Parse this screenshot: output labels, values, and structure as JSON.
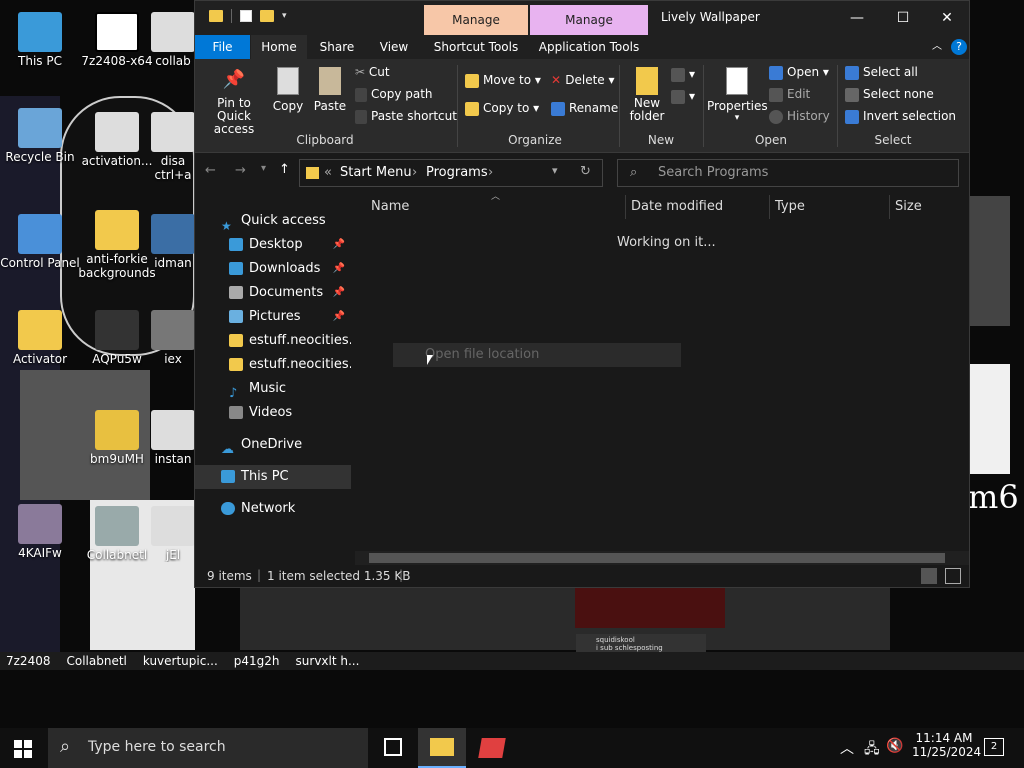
{
  "colors": {
    "accent": "#0078d7",
    "folder": "#f2c94c",
    "manage1": "#f7c7a8",
    "manage2": "#e8b3f0"
  },
  "desktop_icons": [
    {
      "label": "This PC"
    },
    {
      "label": "7z2408-x64"
    },
    {
      "label": "collab"
    },
    {
      "label": "Recycle Bin"
    },
    {
      "label": "activation..."
    },
    {
      "label": "disa ctrl+a"
    },
    {
      "label": "Control Panel"
    },
    {
      "label": "anti-forkie backgrounds"
    },
    {
      "label": "idman"
    },
    {
      "label": "Activator"
    },
    {
      "label": "AQPu5w"
    },
    {
      "label": "iex"
    },
    {
      "label": "bm9uMH"
    },
    {
      "label": "instan"
    },
    {
      "label": "4KAIFw"
    },
    {
      "label": "Collabnetl"
    },
    {
      "label": "jEl"
    }
  ],
  "wallpaper_bar": {
    "items": [
      "7z2408",
      "Collabnetl",
      "kuvertupic...",
      "p41g2h",
      "survxlt h..."
    ],
    "overlay_text": "m6",
    "chat_text": "squidiskool",
    "chat_sub": "i sub schlesposting"
  },
  "explorer": {
    "title": "Lively Wallpaper",
    "context_tabs": [
      "Manage",
      "Manage"
    ],
    "context_labels": [
      "Shortcut Tools",
      "Application Tools"
    ],
    "tabs": [
      "File",
      "Home",
      "Share",
      "View"
    ],
    "ribbon": {
      "clipboard": {
        "pin": "Pin to Quick access",
        "copy": "Copy",
        "paste": "Paste",
        "cut": "Cut",
        "copy_path": "Copy path",
        "paste_shortcut": "Paste shortcut",
        "group": "Clipboard"
      },
      "organize": {
        "move_to": "Move to",
        "copy_to": "Copy to",
        "delete": "Delete",
        "rename": "Rename",
        "group": "Organize"
      },
      "new": {
        "new_folder": "New folder",
        "group": "New"
      },
      "open": {
        "properties": "Properties",
        "open": "Open",
        "edit": "Edit",
        "history": "History",
        "group": "Open"
      },
      "select": {
        "select_all": "Select all",
        "select_none": "Select none",
        "invert": "Invert selection",
        "group": "Select"
      }
    },
    "address": {
      "prefix": "«",
      "crumbs": [
        "Start Menu",
        "Programs"
      ],
      "search_placeholder": "Search Programs"
    },
    "nav": [
      {
        "label": "Quick access",
        "icon": "star-icon",
        "pinned": false
      },
      {
        "label": "Desktop",
        "icon": "desktop-icon",
        "pinned": true
      },
      {
        "label": "Downloads",
        "icon": "download-icon",
        "pinned": true
      },
      {
        "label": "Documents",
        "icon": "document-icon",
        "pinned": true
      },
      {
        "label": "Pictures",
        "icon": "picture-icon",
        "pinned": true
      },
      {
        "label": "estuff.neocities.or",
        "icon": "folder-icon",
        "pinned": false
      },
      {
        "label": "estuff.neocities.or",
        "icon": "folder-icon",
        "pinned": false
      },
      {
        "label": "Music",
        "icon": "music-icon",
        "pinned": false
      },
      {
        "label": "Videos",
        "icon": "video-icon",
        "pinned": false
      },
      {
        "label": "OneDrive",
        "icon": "cloud-icon",
        "pinned": false
      },
      {
        "label": "This PC",
        "icon": "computer-icon",
        "pinned": false
      },
      {
        "label": "Network",
        "icon": "network-icon",
        "pinned": false
      }
    ],
    "columns": [
      "Name",
      "Date modified",
      "Type",
      "Size"
    ],
    "loading": "Working on it...",
    "tooltip": "Open file location",
    "status": {
      "items": "9 items",
      "selected": "1 item selected  1.35 KB"
    }
  },
  "taskbar": {
    "search_placeholder": "Type here to search",
    "time": "11:14 AM",
    "date": "11/25/2024",
    "notifications": "2"
  }
}
